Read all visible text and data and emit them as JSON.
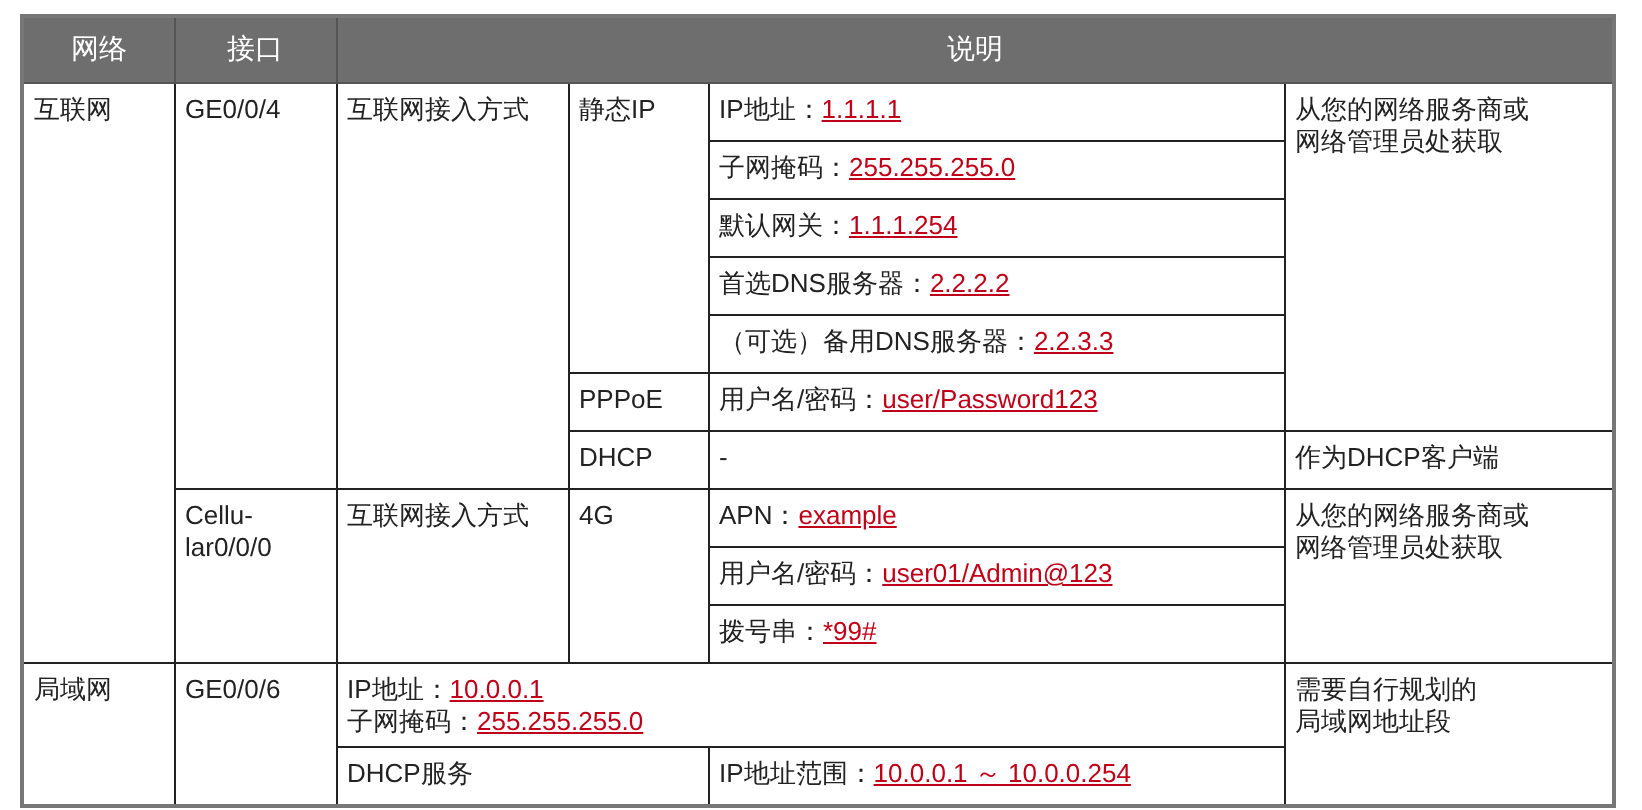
{
  "table": {
    "columns": [
      {
        "label": "网络"
      },
      {
        "label": "接口"
      },
      {
        "label": "说明",
        "colspan": 4
      }
    ],
    "rows": [
      [
        {
          "kind": "text",
          "lines": [
            "互联网"
          ],
          "rowspan": 10
        },
        {
          "kind": "text",
          "lines": [
            "GE0/0/4"
          ],
          "rowspan": 7
        },
        {
          "kind": "text",
          "lines": [
            "互联网接入方式"
          ],
          "rowspan": 7
        },
        {
          "kind": "text",
          "lines": [
            "静态IP"
          ],
          "rowspan": 5
        },
        {
          "kind": "field",
          "label": "IP地址：",
          "value": "1.1.1.1"
        },
        {
          "kind": "text",
          "lines": [
            "从您的网络服务商或",
            "网络管理员处获取"
          ],
          "rowspan": 6
        }
      ],
      [
        {
          "kind": "field",
          "label": "子网掩码：",
          "value": "255.255.255.0"
        }
      ],
      [
        {
          "kind": "field",
          "label": "默认网关：",
          "value": "1.1.1.254"
        }
      ],
      [
        {
          "kind": "field",
          "label": "首选DNS服务器：",
          "value": "2.2.2.2"
        }
      ],
      [
        {
          "kind": "field",
          "label": "（可选）备用DNS服务器：",
          "value": "2.2.3.3"
        }
      ],
      [
        {
          "kind": "text",
          "lines": [
            "PPPoE"
          ]
        },
        {
          "kind": "field",
          "label": "用户名/密码：",
          "value": "user/Password123"
        }
      ],
      [
        {
          "kind": "text",
          "lines": [
            "DHCP"
          ]
        },
        {
          "kind": "text",
          "lines": [
            "-"
          ]
        },
        {
          "kind": "text",
          "lines": [
            "作为DHCP客户端"
          ]
        }
      ],
      [
        {
          "kind": "text",
          "lines": [
            "Cellu-",
            "lar0/0/0"
          ],
          "rowspan": 3
        },
        {
          "kind": "text",
          "lines": [
            "互联网接入方式"
          ],
          "rowspan": 3
        },
        {
          "kind": "text",
          "lines": [
            "4G"
          ],
          "rowspan": 3
        },
        {
          "kind": "field",
          "label": "APN：",
          "value": "example"
        },
        {
          "kind": "text",
          "lines": [
            "从您的网络服务商或",
            "网络管理员处获取"
          ],
          "rowspan": 3
        }
      ],
      [
        {
          "kind": "field",
          "label": "用户名/密码：",
          "value": "user01/Admin@123"
        }
      ],
      [
        {
          "kind": "field",
          "label": "拨号串：",
          "value": "*99#"
        }
      ],
      [
        {
          "kind": "text",
          "lines": [
            "局域网"
          ],
          "rowspan": 2
        },
        {
          "kind": "text",
          "lines": [
            "GE0/0/6"
          ],
          "rowspan": 2
        },
        {
          "kind": "fields",
          "colspan": 3,
          "items": [
            {
              "label": "IP地址：",
              "value": "10.0.0.1"
            },
            {
              "label": "子网掩码：",
              "value": "255.255.255.0"
            }
          ]
        },
        {
          "kind": "text",
          "lines": [
            "需要自行规划的",
            "局域网地址段"
          ],
          "rowspan": 2
        }
      ],
      [
        {
          "kind": "text",
          "lines": [
            "DHCP服务"
          ],
          "colspan": 2
        },
        {
          "kind": "field",
          "label": "IP地址范围：",
          "value": "10.0.0.1 ～ 10.0.0.254"
        }
      ]
    ]
  }
}
